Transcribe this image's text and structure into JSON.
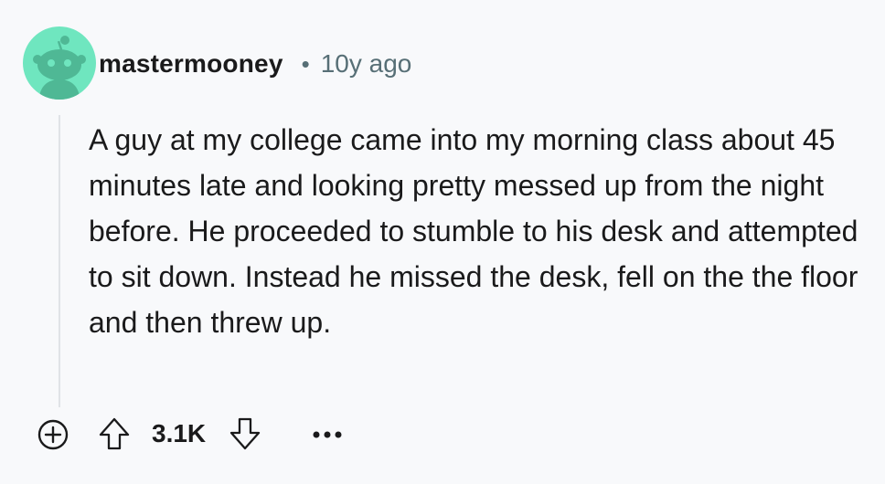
{
  "comment": {
    "username": "mastermooney",
    "separator": "•",
    "timestamp": "10y ago",
    "body": "A guy at my college came into my morning class about 45 minutes late and looking pretty messed up from the night before. He proceeded to stumble to his desk and attempted to sit down. Instead he missed the desk, fell on the the floor and then threw up."
  },
  "actions": {
    "expand_icon": "plus-circle-icon",
    "upvote_icon": "arrow-up-icon",
    "score": "3.1K",
    "downvote_icon": "arrow-down-icon",
    "more_icon": "ellipsis-icon"
  },
  "colors": {
    "background": "#f8f9fb",
    "avatar_background": "#6fe6bf",
    "text": "#1a1a1b",
    "meta_text": "#576f76",
    "thread_line": "#e0e3e7"
  }
}
